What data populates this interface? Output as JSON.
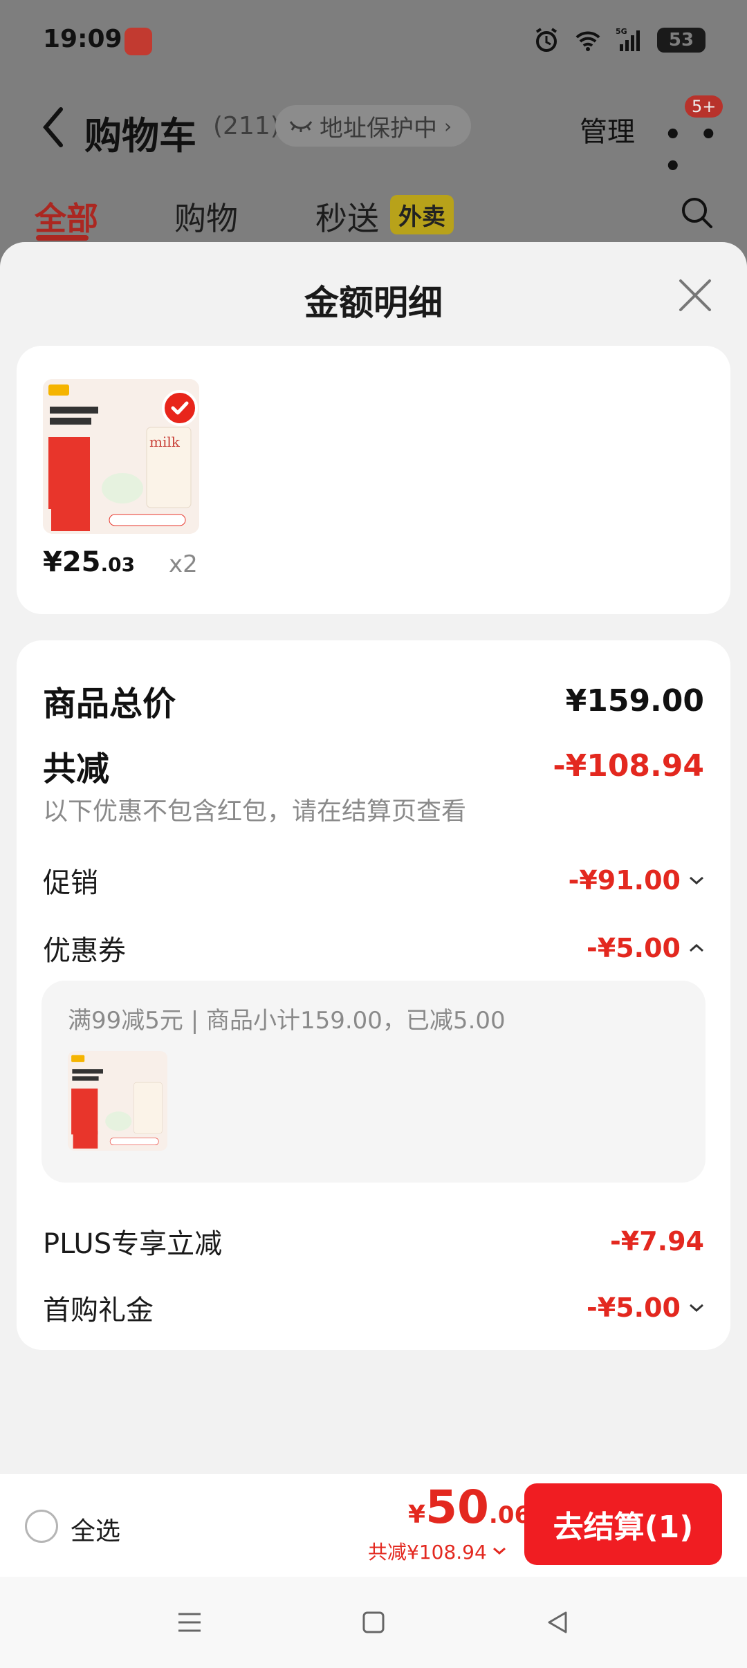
{
  "status": {
    "time": "19:09",
    "signal": "5G",
    "battery": "53"
  },
  "header": {
    "title": "购物车",
    "count": "(211)",
    "address_pill": "地址保护中",
    "manage": "管理",
    "more_badge": "5+"
  },
  "tabs": [
    {
      "label": "全部",
      "active": true
    },
    {
      "label": "购物"
    },
    {
      "label": "秒送"
    }
  ],
  "tab_badge": "外卖",
  "sheet": {
    "title": "金额明细",
    "product": {
      "price_int": "¥25",
      "price_dec": ".03",
      "qty": "x2"
    },
    "total_label": "商品总价",
    "total_value": "¥159.00",
    "reduce_label": "共减",
    "reduce_value": "-¥108.94",
    "reduce_note": "以下优惠不包含红包，请在结算页查看",
    "lines": [
      {
        "label": "促销",
        "value": "-¥91.00"
      },
      {
        "label": "优惠券",
        "value": "-¥5.00"
      },
      {
        "label": "PLUS专享立减",
        "value": "-¥7.94"
      },
      {
        "label": "首购礼金",
        "value": "-¥5.00"
      }
    ],
    "coupon_detail": "满99减5元 | 商品小计159.00，已减5.00"
  },
  "bottom": {
    "select_all": "全选",
    "price_yen": "¥",
    "price_int": "50",
    "price_dec": ".06",
    "saved": "共减¥108.94",
    "checkout": "去结算(1)"
  },
  "colors": {
    "accent": "#e3281f",
    "button": "#f01d22"
  }
}
